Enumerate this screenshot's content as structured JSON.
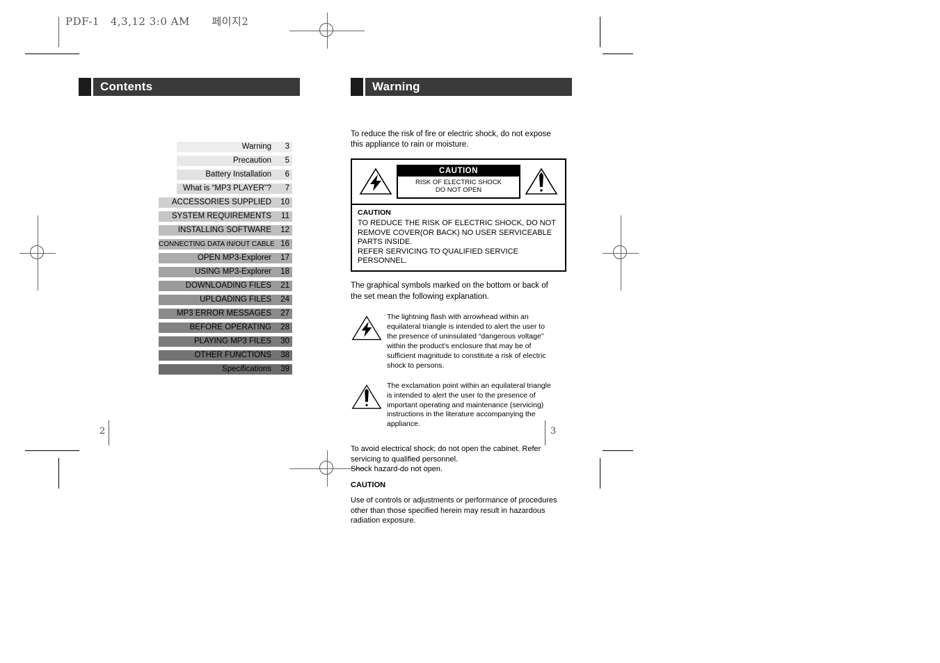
{
  "film_header": {
    "text": "PDF-1   4,3,12 3:0 AM      페이지2"
  },
  "left_page": {
    "section_title": "Contents",
    "folio": "2",
    "toc": [
      {
        "label": "Warning",
        "page": "3",
        "shade": "#ededed",
        "wide": false
      },
      {
        "label": "Precaution",
        "page": "5",
        "shade": "#e8e8e8",
        "wide": false
      },
      {
        "label": "Battery Installation",
        "page": "6",
        "shade": "#e2e2e2",
        "wide": false
      },
      {
        "label": "What is  “MP3 PLAYER”?",
        "page": "7",
        "shade": "#d9d9d9",
        "wide": false
      },
      {
        "label": "ACCESSORIES SUPPLIED",
        "page": "10",
        "shade": "#cfcfcf",
        "wide": true
      },
      {
        "label": "SYSTEM REQUIREMENTS",
        "page": "11",
        "shade": "#c6c6c6",
        "wide": true
      },
      {
        "label": "INSTALLING SOFTWARE",
        "page": "12",
        "shade": "#bdbdbd",
        "wide": true
      },
      {
        "label": "CONNECTING DATA IN/OUT CABLE",
        "page": "16",
        "shade": "#b4b4b4",
        "wide": true
      },
      {
        "label": "OPEN MP3-Explorer",
        "page": "17",
        "shade": "#ababab",
        "wide": true
      },
      {
        "label": "USING MP3-Explorer",
        "page": "18",
        "shade": "#a3a3a3",
        "wide": true
      },
      {
        "label": "DOWNLOADING FILES",
        "page": "21",
        "shade": "#9b9b9b",
        "wide": true
      },
      {
        "label": "UPLOADING FILES",
        "page": "24",
        "shade": "#939393",
        "wide": true
      },
      {
        "label": "MP3 ERROR MESSAGES",
        "page": "27",
        "shade": "#8b8b8b",
        "wide": true
      },
      {
        "label": "BEFORE OPERATING",
        "page": "28",
        "shade": "#838383",
        "wide": true
      },
      {
        "label": "PLAYING MP3 FILES",
        "page": "30",
        "shade": "#7b7b7b",
        "wide": true
      },
      {
        "label": "OTHER FUNCTIONS",
        "page": "38",
        "shade": "#737373",
        "wide": true
      },
      {
        "label": "Specifications",
        "page": "39",
        "shade": "#6b6b6b",
        "wide": true
      }
    ]
  },
  "right_page": {
    "section_title": "Warning",
    "folio": "3",
    "intro": "To reduce the risk of fire or electric shock, do not expose this appliance to rain or moisture.",
    "caution_box": {
      "plate_head": "CAUTION",
      "plate_line1": "RISK OF ELECTRIC SHOCK",
      "plate_line2": "DO NOT OPEN",
      "bottom_title": "CAUTION",
      "bottom_text": "TO REDUCE THE RISK OF ELECTRIC SHOCK, DO NOT REMOVE COVER(OR BACK) NO USER SERVICEABLE PARTS INSIDE.\nREFER SERVICING TO QUALIFIED SERVICE PERSONNEL."
    },
    "symbols_intro": "The graphical symbols marked on the bottom or back of the set mean the following explanation.",
    "symbol_bolt_text": "The lightning flash with arrowhead within an equilateral triangle is intended to alert the user to the presence of uninsulated “dangerous voltage” within the product's enclosure that may be of sufficient magnitude to constitute a risk of electric shock to persons.",
    "symbol_bang_text": "The exclamation point within an equilateral triangle is intended to alert the user to the presence of important operating and maintenance (servicing) instructions in the literature accompanying the appliance.",
    "tail_text": "To avoid electrical shock; do not open the cabinet. Refer servicing to qualified personnel.\nShock hazard-do not open.",
    "tail_caution_title": "CAUTION",
    "tail_text2": "Use of controls or adjustments or performance of procedures other than those specified herein may result in hazardous radiation exposure."
  },
  "colors": {
    "header_block": "#1b1b1b",
    "header_bar": "#3a3a3a",
    "mark": "#000000",
    "regmark": "#555555"
  }
}
